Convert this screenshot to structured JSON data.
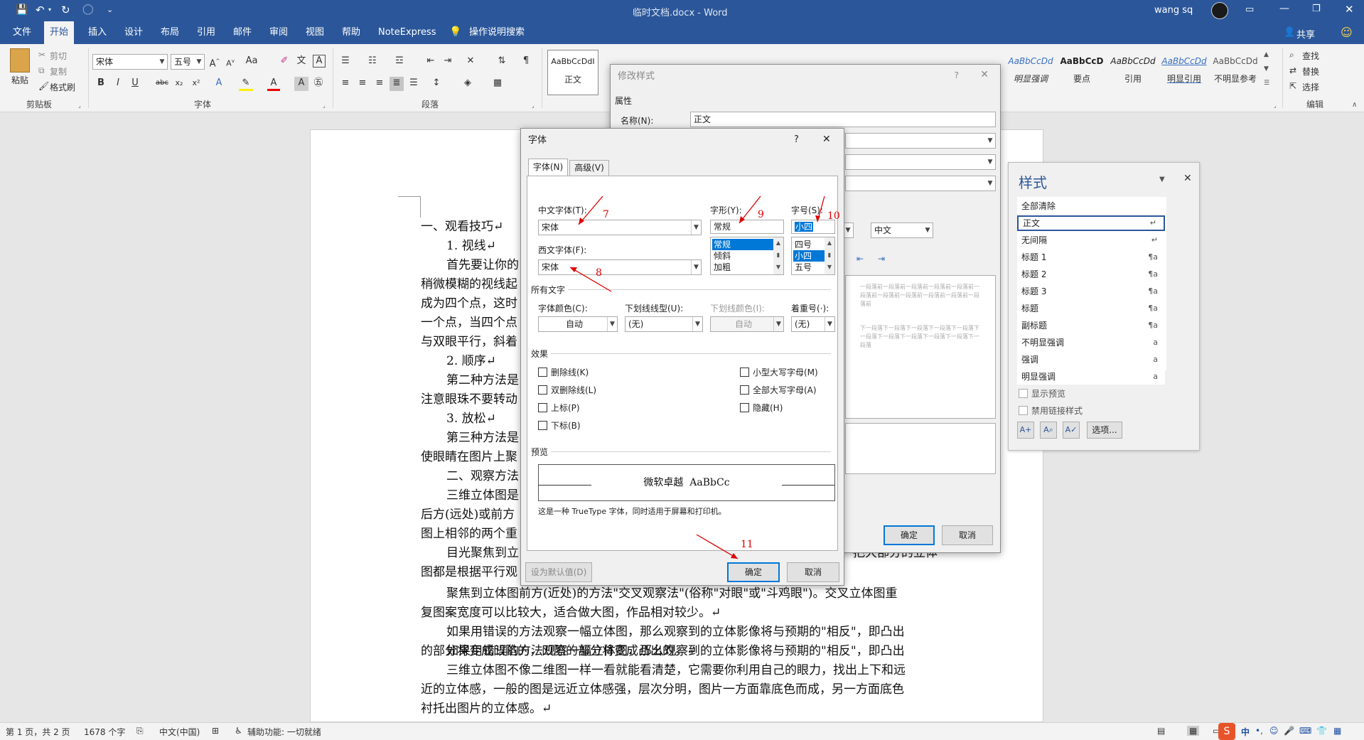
{
  "titlebar": {
    "doc_title": "临时文档.docx - Word",
    "user": "wang sq",
    "qat_more": "⌄"
  },
  "tabs": [
    {
      "label": "文件"
    },
    {
      "label": "开始"
    },
    {
      "label": "插入"
    },
    {
      "label": "设计"
    },
    {
      "label": "布局"
    },
    {
      "label": "引用"
    },
    {
      "label": "邮件"
    },
    {
      "label": "审阅"
    },
    {
      "label": "视图"
    },
    {
      "label": "帮助"
    },
    {
      "label": "NoteExpress"
    },
    {
      "label": "操作说明搜索"
    }
  ],
  "share_label": "共享",
  "clipboard": {
    "paste": "粘贴",
    "cut": "剪切",
    "copy": "复制",
    "painter": "格式刷",
    "group": "剪贴板"
  },
  "font_group": {
    "font_name": "宋体",
    "font_size": "五号",
    "group": "字体"
  },
  "paragraph_group": {
    "group": "段落"
  },
  "styles_gallery": [
    {
      "sample": "AaBbCcDdI",
      "name": "正文"
    },
    {
      "sample": "AaBbCcDd",
      "name": "明显强调"
    },
    {
      "sample": "AaBbCcD",
      "name": "要点"
    },
    {
      "sample": "AaBbCcDd",
      "name": "引用"
    },
    {
      "sample": "AaBbCcDd",
      "name": "明显引用"
    },
    {
      "sample": "AaBbCcDd",
      "name": "不明显参考"
    }
  ],
  "editing": {
    "find": "查找",
    "replace": "替换",
    "select": "选择",
    "group": "编辑"
  },
  "document": {
    "lines": [
      "一、观看技巧↵",
      "1. 视线↵",
      "首先要让你的",
      "稍微模糊的视线起",
      "成为四个点，这时",
      "一个点，当四个点",
      "与双眼平行，斜着",
      "2. 顺序↵",
      "第二种方法是",
      "注意眼珠不要转动",
      "3. 放松↵",
      "第三种方法是",
      "使眼睛在图片上聚",
      "二、观察方法",
      "三维立体图是",
      "后方(远处)或前方",
      "图上相邻的两个重",
      "目光聚焦到立",
      "图都是根据平行观",
      "聚焦到立体图前方(近处)的方法\"交叉观察法\"(俗称\"对眼\"或\"斗鸡眼\")。交叉立体图重",
      "复图案宽度可以比较大，适合做大图，作品相对较少。↵",
      "如果用错误的方法观察一幅立体图，那么观察到的立体影像将与预期的\"相反\"，即凸出",
      "的部分将变成凹陷的，凹陷的部分将变成凸出的。↵",
      "三维立体图不像二维图一样一看就能看清楚，它需要你利用自己的眼力，找出上下和远",
      "近的立体感，一般的图是远近立体感强，层次分明，图片一方面靠底色而成，另一方面底色",
      "衬托出图片的立体感。↵"
    ],
    "tail_fragment": "把大部分的立体"
  },
  "modify_style_dialog": {
    "title": "修改样式",
    "section": "属性",
    "name_label": "名称(N):",
    "name_value": "正文",
    "lang_value": "中文",
    "ok": "确定",
    "cancel": "取消",
    "preview_text": "一段落前一段落前一段落前一段落前一段落前一段落前一段落前一段落前一段落前一段落前一段落前",
    "preview_text2": "下一段落下一段落下一段落下一段落下一段落下一段落下一段落下一段落下一段落下一段落下一段落"
  },
  "font_dialog": {
    "title": "字体",
    "help": "?",
    "close": "✕",
    "tabs": [
      "字体(N)",
      "高级(V)"
    ],
    "cn_font_label": "中文字体(T):",
    "cn_font_value": "宋体",
    "west_font_label": "西文字体(F):",
    "west_font_value": "宋体",
    "style_label": "字形(Y):",
    "style_value": "常规",
    "style_options": [
      "常规",
      "倾斜",
      "加粗"
    ],
    "size_label": "字号(S):",
    "size_value": "小四",
    "size_options": [
      "四号",
      "小四",
      "五号"
    ],
    "all_text_section": "所有文字",
    "color_label": "字体颜色(C):",
    "color_value": "自动",
    "underline_label": "下划线线型(U):",
    "underline_value": "(无)",
    "underline_color_label": "下划线颜色(I):",
    "underline_color_value": "自动",
    "emphasis_label": "着重号(·):",
    "emphasis_value": "(无)",
    "effects_section": "效果",
    "effects_left": [
      "删除线(K)",
      "双删除线(L)",
      "上标(P)",
      "下标(B)"
    ],
    "effects_right": [
      "小型大写字母(M)",
      "全部大写字母(A)",
      "隐藏(H)"
    ],
    "preview_section": "预览",
    "preview_text": "微软卓越  AaBbCc",
    "truetype_note": "这是一种 TrueType 字体，同时适用于屏幕和打印机。",
    "set_default": "设为默认值(D)",
    "ok": "确定",
    "cancel": "取消"
  },
  "annotations": [
    "7",
    "8",
    "9",
    "10",
    "11"
  ],
  "styles_panel": {
    "title": "样式",
    "items": [
      {
        "name": "全部清除",
        "mark": ""
      },
      {
        "name": "正文",
        "mark": "↵"
      },
      {
        "name": "无间隔",
        "mark": "↵"
      },
      {
        "name": "标题 1",
        "mark": "¶a"
      },
      {
        "name": "标题 2",
        "mark": "¶a"
      },
      {
        "name": "标题 3",
        "mark": "¶a"
      },
      {
        "name": "标题",
        "mark": "¶a"
      },
      {
        "name": "副标题",
        "mark": "¶a"
      },
      {
        "name": "不明显强调",
        "mark": "a"
      },
      {
        "name": "强调",
        "mark": "a"
      },
      {
        "name": "明显强调",
        "mark": "a"
      }
    ],
    "show_preview": "显示预览",
    "disable_linked": "禁用链接样式",
    "options": "选项..."
  },
  "statusbar": {
    "page": "第 1 页，共 2 页",
    "words": "1678 个字",
    "lang": "中文(中国)",
    "accessibility": "辅助功能: 一切就绪",
    "ime": "中"
  },
  "colors": {
    "brand": "#2b579a",
    "accent": "#0078d7",
    "annotation": "#dd0000"
  }
}
